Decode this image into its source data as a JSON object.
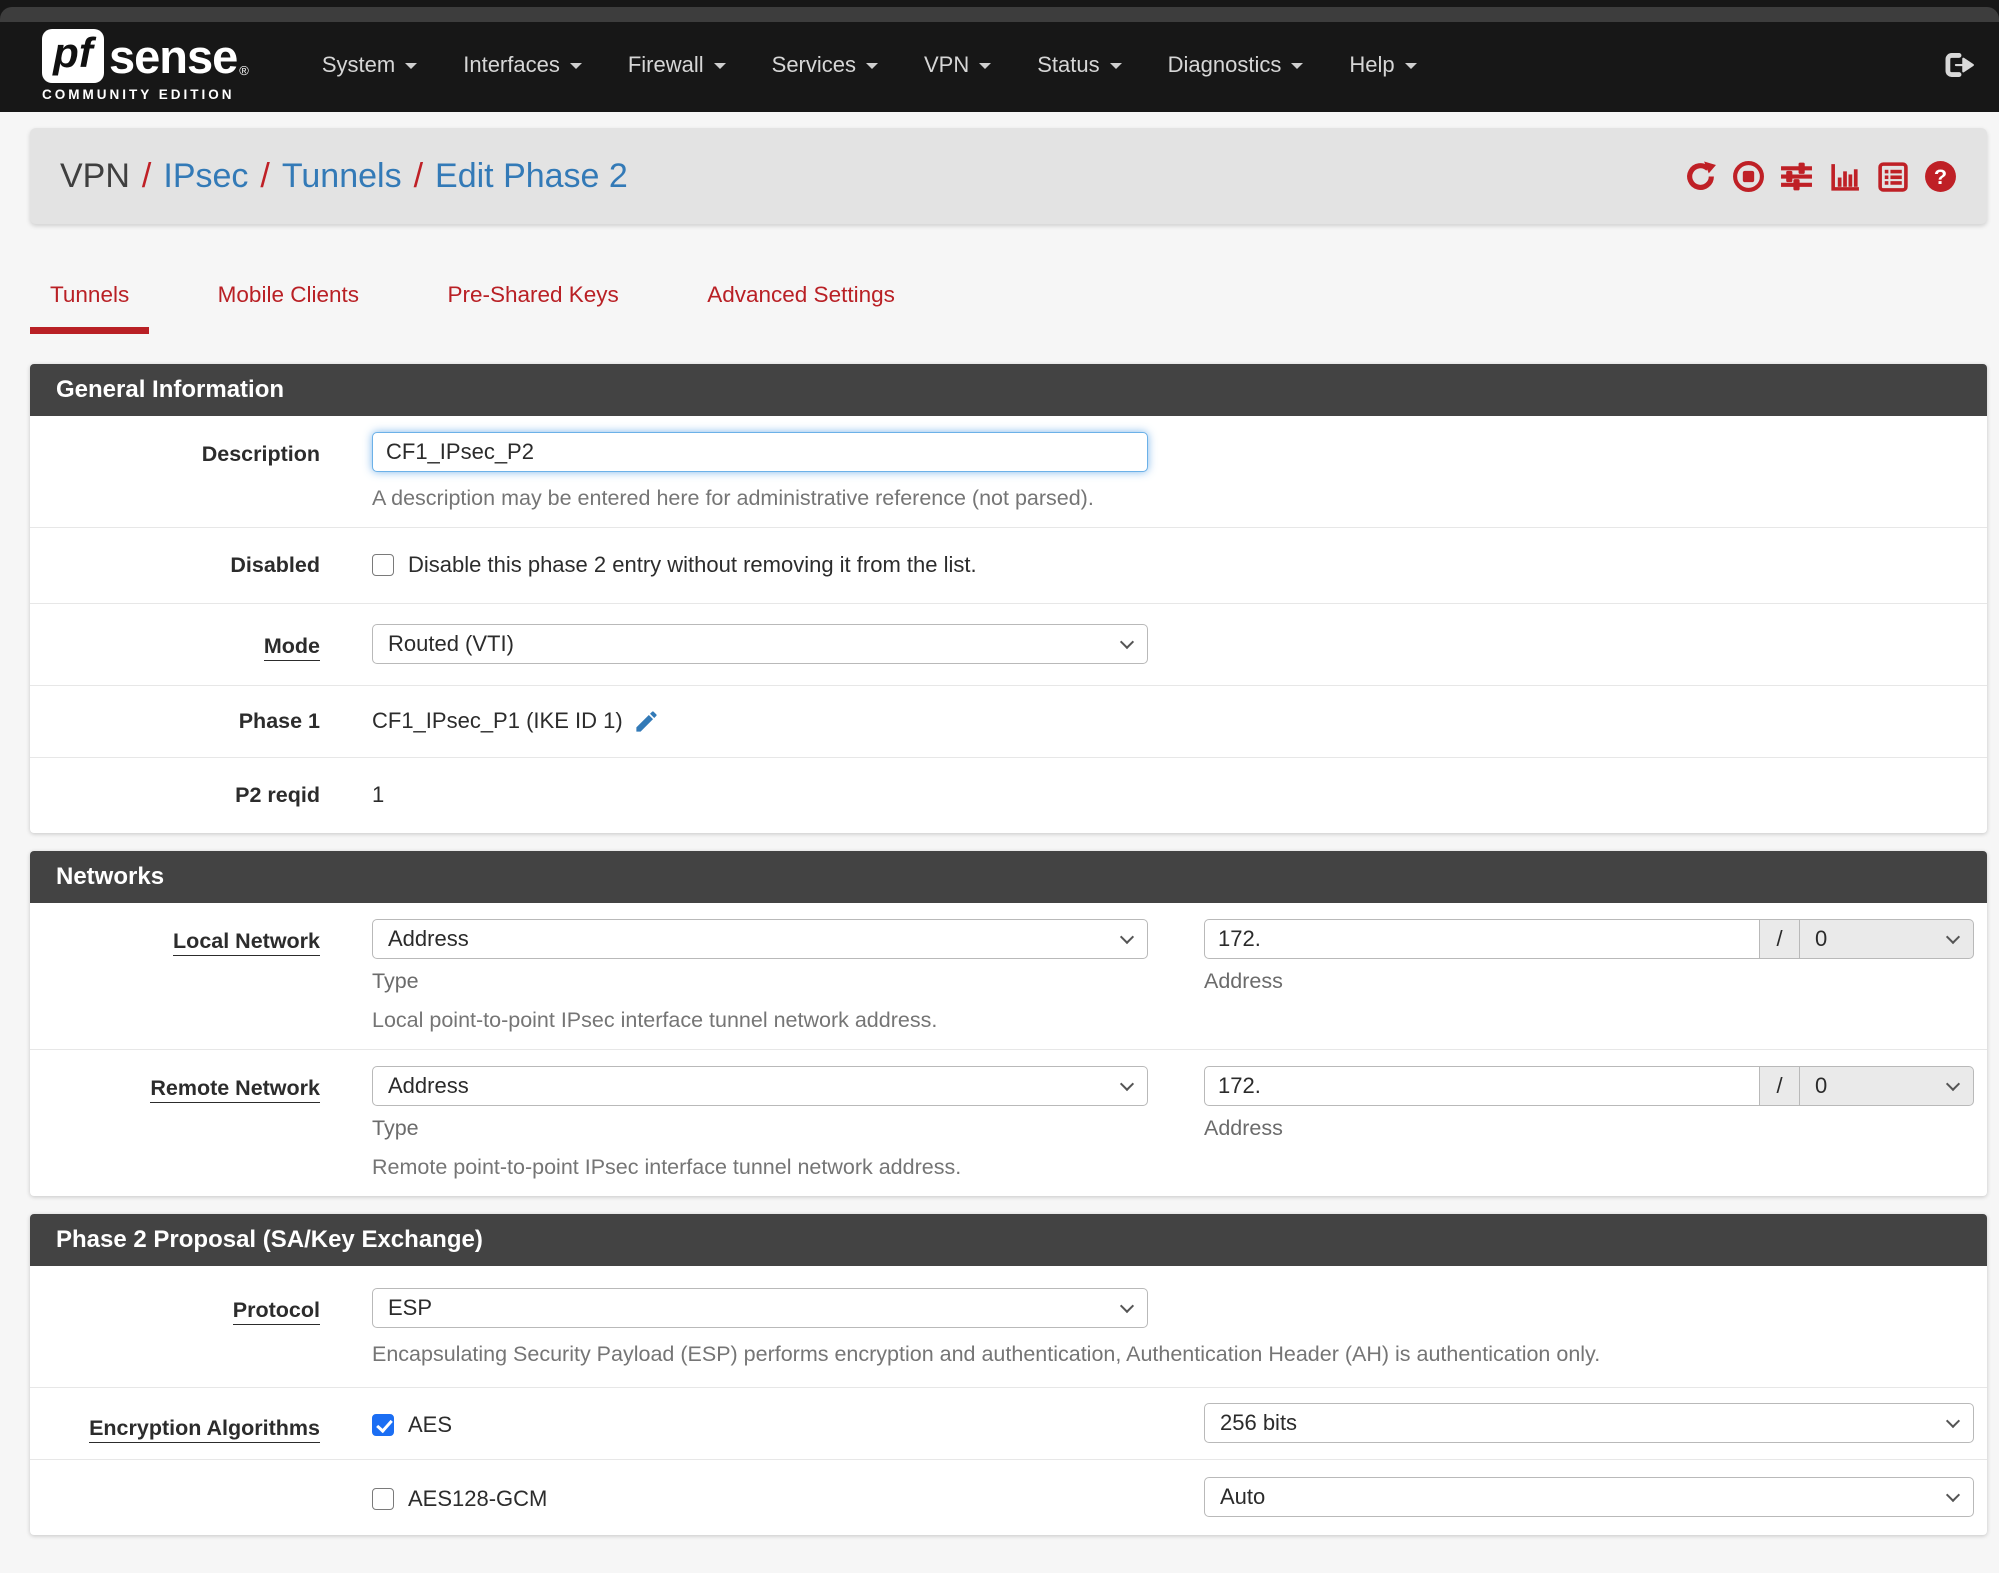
{
  "colors": {
    "accent_red": "#bf2026",
    "link_blue": "#337ab7",
    "header_bar": "#434343",
    "checkbox_blue": "#1b6ef3",
    "navbar_bg": "#171717"
  },
  "navbar": {
    "brand_pf": "pf",
    "brand_sense": "sense",
    "brand_reg": "®",
    "edition": "COMMUNITY EDITION",
    "items": [
      {
        "label": "System"
      },
      {
        "label": "Interfaces"
      },
      {
        "label": "Firewall"
      },
      {
        "label": "Services"
      },
      {
        "label": "VPN"
      },
      {
        "label": "Status"
      },
      {
        "label": "Diagnostics"
      },
      {
        "label": "Help"
      }
    ]
  },
  "breadcrumb": {
    "separator": "/",
    "items": [
      {
        "label": "VPN"
      },
      {
        "label": "IPsec"
      },
      {
        "label": "Tunnels"
      },
      {
        "label": "Edit Phase 2"
      }
    ]
  },
  "icons": {
    "help_glyph": "?"
  },
  "tabs": [
    {
      "label": "Tunnels",
      "active": true
    },
    {
      "label": "Mobile Clients",
      "active": false
    },
    {
      "label": "Pre-Shared Keys",
      "active": false
    },
    {
      "label": "Advanced Settings",
      "active": false
    }
  ],
  "general": {
    "title": "General Information",
    "description_label": "Description",
    "description_value": "CF1_IPsec_P2",
    "description_help": "A description may be entered here for administrative reference (not parsed).",
    "disabled_label": "Disabled",
    "disabled_checkbox_label": "Disable this phase 2 entry without removing it from the list.",
    "disabled_checked": false,
    "mode_label": "Mode",
    "mode_value": "Routed (VTI)",
    "phase1_label": "Phase 1",
    "phase1_value": "CF1_IPsec_P1 (IKE ID 1)",
    "p2reqid_label": "P2 reqid",
    "p2reqid_value": "1"
  },
  "networks": {
    "title": "Networks",
    "local_label": "Local Network",
    "remote_label": "Remote Network",
    "type_label": "Type",
    "address_label": "Address",
    "local_type_value": "Address",
    "remote_type_value": "Address",
    "local_address_value": "172.",
    "remote_address_value": "172.",
    "slash": "/",
    "local_mask_value": "0",
    "remote_mask_value": "0",
    "local_help": "Local point-to-point IPsec interface tunnel network address.",
    "remote_help": "Remote point-to-point IPsec interface tunnel network address."
  },
  "proposal": {
    "title": "Phase 2 Proposal (SA/Key Exchange)",
    "protocol_label": "Protocol",
    "protocol_value": "ESP",
    "protocol_help": "Encapsulating Security Payload (ESP) performs encryption and authentication, Authentication Header (AH) is authentication only.",
    "encryption_label": "Encryption Algorithms",
    "algorithms": [
      {
        "name": "AES",
        "checked": true,
        "bits": "256 bits"
      },
      {
        "name": "AES128-GCM",
        "checked": false,
        "bits": "Auto"
      }
    ]
  }
}
